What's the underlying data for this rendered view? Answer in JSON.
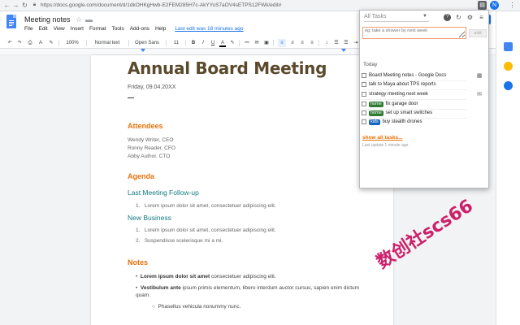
{
  "browser": {
    "url": "https://docs.google.com/document/d/1dkOHKgHwb-E2FEM285H7c-AkYYoS7aOV4sETPS12FWk/edit#",
    "avatar_letter": "N",
    "extension_letter": "N"
  },
  "docs": {
    "title": "Meeting notes",
    "menu": [
      "File",
      "Edit",
      "View",
      "Insert",
      "Format",
      "Tools",
      "Add-ons",
      "Help"
    ],
    "last_edit": "Last edit was 18 minutes ago",
    "toolbar": {
      "zoom": "100%",
      "style": "Normal text",
      "font": "Open Sans",
      "size": "11"
    }
  },
  "document": {
    "title": "Annual Board Meeting",
    "date": "Friday, 09.04.20XX",
    "attendees_heading": "Attendees",
    "attendees": [
      "Wendy Writer, CEO",
      "Ronny Reader, CFO",
      "Abby Author, CTO"
    ],
    "agenda_heading": "Agenda",
    "follow_up_heading": "Last Meeting Follow-up",
    "follow_up_items": [
      "Lorem ipsum dolor sit amet, consectetuer adipiscing elit."
    ],
    "new_business_heading": "New Business",
    "new_business_items": [
      "Lorem ipsum dolor sit amet, consectetuer adipiscing elit.",
      "Suspendisse scelerisque mi a mi."
    ],
    "notes_heading": "Notes",
    "notes": [
      {
        "bold": "Lorem ipsum dolor sit amet",
        "rest": " consectetuer adipiscing elit."
      },
      {
        "bold": "Vestibulum ante",
        "rest": " ipsum primis elementum, libero interdum auctor cursus, sapien enim dictum quam."
      }
    ],
    "sub_note": "Phasellus vehicula nonummy nunc."
  },
  "tasks_popup": {
    "list_name": "All Tasks",
    "new_task_placeholder": "eg: take a shower by next week",
    "add_label": "add",
    "section": "Today",
    "tasks": [
      {
        "text": "Board Meeting notes - Google Docs",
        "tag": "",
        "tag_color": ""
      },
      {
        "text": "talk to Maya about TPS reports",
        "tag": "",
        "tag_color": ""
      },
      {
        "text": "strategy meeting next week",
        "tag": "",
        "tag_color": ""
      },
      {
        "text": "fix garage door",
        "tag": "home",
        "tag_color": "#2e7d32"
      },
      {
        "text": "set up smart switches",
        "tag": "home",
        "tag_color": "#2e7d32"
      },
      {
        "text": "buy stealth drones",
        "tag": "kids",
        "tag_color": "#1565c0"
      }
    ],
    "show_all": "show all tasks...",
    "last_update": "Last update 1 minute ago"
  },
  "watermark": "数创社scs66"
}
